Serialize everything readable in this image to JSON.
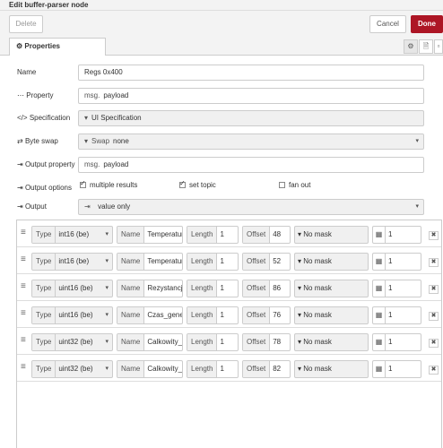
{
  "window": {
    "title": "Edit buffer-parser node"
  },
  "toolbar": {
    "delete_label": "Delete",
    "cancel_label": "Cancel",
    "done_label": "Done"
  },
  "tabs": {
    "properties_label": "Properties",
    "gear_icon": "⚙",
    "doc_icon": "🗎",
    "more_icon": "▫"
  },
  "form": {
    "name_label": "Name",
    "name_value": "Regs 0x400",
    "property_label": "Property",
    "property_prefix": "msg.",
    "property_value": "payload",
    "spec_label": "Specification",
    "spec_value": "UI Specification",
    "byteswap_label": "Byte swap",
    "byteswap_prefix": "Swap",
    "byteswap_value": "none",
    "output_property_label": "Output property",
    "output_property_prefix": "msg.",
    "output_property_value": "payload",
    "output_options_label": "Output options",
    "multiple_results_label": "multiple results",
    "set_topic_label": "set topic",
    "fan_out_label": "fan out",
    "output_label": "Output",
    "output_value": "value only"
  },
  "icons": {
    "name": "▭",
    "property": "⋯",
    "spec": "</>",
    "byteswap": "⇄",
    "output_property": "⇥",
    "output_options": "⇥",
    "output": "⇥",
    "caret": "▾",
    "handle": "≡",
    "calc": "▦",
    "delete": "✖"
  },
  "checks": {
    "multiple_results": true,
    "set_topic": true,
    "fan_out": false
  },
  "items_labels": {
    "type": "Type",
    "name": "Name",
    "length": "Length",
    "offset": "Offset"
  },
  "items": [
    {
      "type": "int16 (be)",
      "name": "Temperatura",
      "length": "1",
      "offset": "48",
      "mask": "No mask",
      "scale": "1"
    },
    {
      "type": "int16 (be)",
      "name": "Temperatura",
      "length": "1",
      "offset": "52",
      "mask": "No mask",
      "scale": "1"
    },
    {
      "type": "uint16 (be)",
      "name": "Rezystancja_",
      "length": "1",
      "offset": "86",
      "mask": "No mask",
      "scale": "1"
    },
    {
      "type": "uint16 (be)",
      "name": "Czas_genera",
      "length": "1",
      "offset": "76",
      "mask": "No mask",
      "scale": "1"
    },
    {
      "type": "uint32 (be)",
      "name": "Calkowity_cz",
      "length": "1",
      "offset": "78",
      "mask": "No mask",
      "scale": "1"
    },
    {
      "type": "uint32 (be)",
      "name": "Calkowity_cz",
      "length": "1",
      "offset": "82",
      "mask": "No mask",
      "scale": "1"
    }
  ]
}
